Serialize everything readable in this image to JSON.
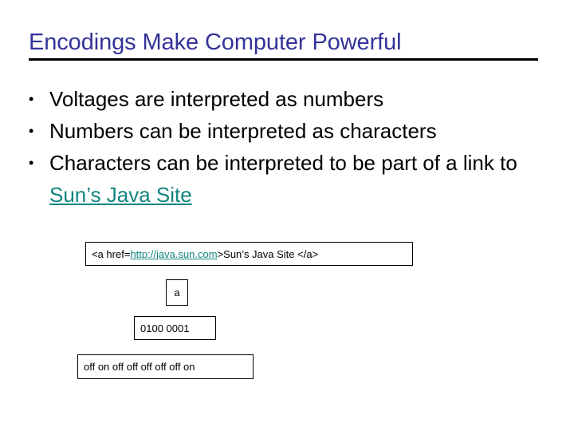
{
  "slide": {
    "title": "Encodings Make Computer Powerful",
    "colors": {
      "title": "#333399",
      "body_text": "#000000",
      "link": "#12847F",
      "rule": "#000000",
      "background": "#FFFFFF",
      "box_border": "#000000"
    },
    "bullets": [
      {
        "marker": "•",
        "text": "Voltages are interpreted as numbers"
      },
      {
        "marker": "•",
        "text_before_link": "Numbers can be interpreted as characters"
      },
      {
        "marker": "•",
        "text_before_link": "Characters can be interpreted to be part of a link to ",
        "link_text": "Sun’s Java Site"
      }
    ],
    "bullet_1_text": "Voltages are interpreted as numbers",
    "bullet_2_text": "Numbers can be interpreted as characters",
    "bullet_3_text_before_link": "Characters can be interpreted to be part of a link to ",
    "bullet_3_link_text": "Sun’s Java Site",
    "bullet_marker": "•",
    "encoding_stack": {
      "html_box": {
        "prefix": "<a href=",
        "url": "http://java.sun.com",
        "suffix": ">Sun’s Java Site </a>"
      },
      "character_box": "a",
      "binary_box": "0100 0001",
      "switches_box": "off on off off   off off off on"
    }
  }
}
